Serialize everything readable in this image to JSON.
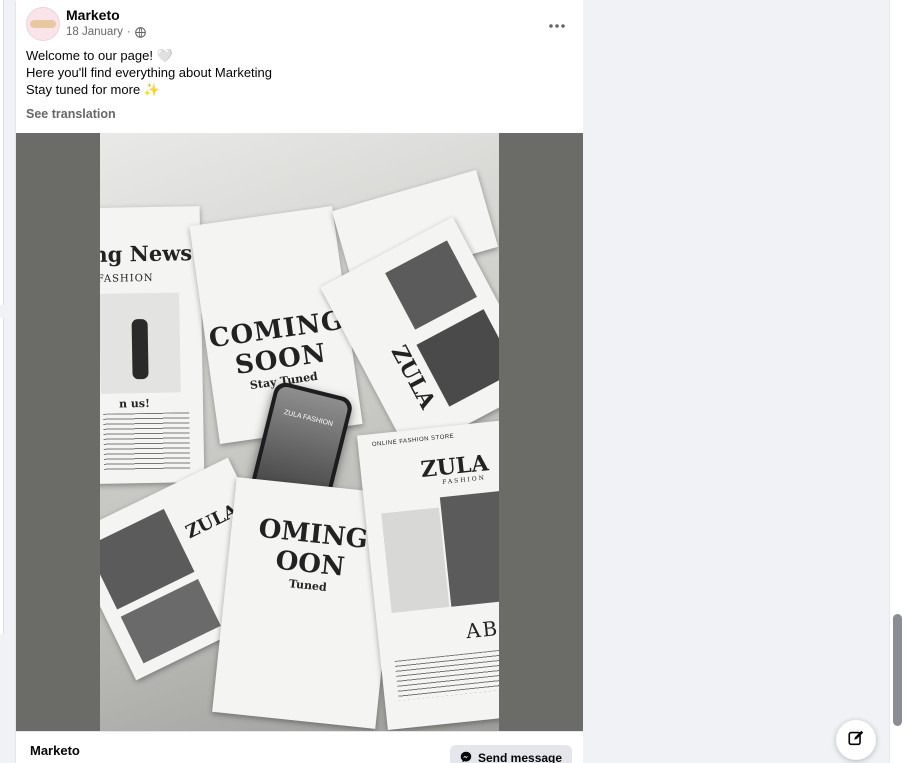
{
  "post": {
    "author": "Marketo",
    "date": "18 January",
    "separator": "·",
    "privacy_icon": "globe-icon",
    "more_icon": "more-options-icon",
    "text_lines": [
      "Welcome to our page! 🤍",
      "Here you'll find everything about Marketing",
      "Stay tuned for more ✨"
    ],
    "see_translation": "See translation"
  },
  "image": {
    "newspaper_headline": "ng News",
    "section_label": "FASHION",
    "coming_soon_1": "COMING",
    "coming_soon_2": "SOON",
    "stay_tuned": "Stay Tuned",
    "phone_brand": "ZULA FASHION",
    "zula_logo": "ZULA",
    "zula_sub": "FASHION",
    "about": "ABO",
    "store_label": "ONLINE FASHION STORE",
    "join_us": "n us!",
    "coming_soon_3": "OMING",
    "coming_soon_4": "OON",
    "tuned": "Tuned"
  },
  "footer": {
    "page_name": "Marketo",
    "send_message": "Send message",
    "messenger_icon": "messenger-icon"
  },
  "floating": {
    "compose_icon": "compose-icon"
  },
  "colors": {
    "background": "#f0f2f5",
    "secondary_text": "#65676b",
    "media_backdrop": "#6b6b67"
  }
}
